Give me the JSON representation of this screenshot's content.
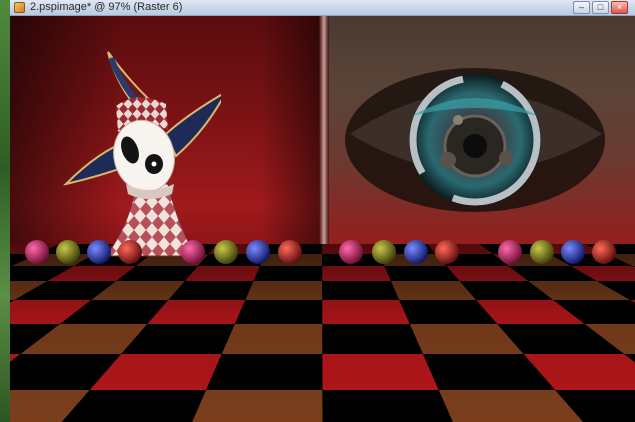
{
  "window": {
    "title": "2.pspimage* @ 97% (Raster 6)",
    "minimize_glyph": "–",
    "maximize_glyph": "□",
    "close_glyph": "×"
  },
  "icons": {
    "app": "psp-image-icon",
    "minimize": "minimize-icon",
    "maximize": "maximize-icon",
    "close": "close-icon"
  },
  "colors": {
    "wall_red": "#a01a1c",
    "floor_red": "#b2161a",
    "floor_brown": "#7a3e1c",
    "floor_black": "#000000"
  }
}
